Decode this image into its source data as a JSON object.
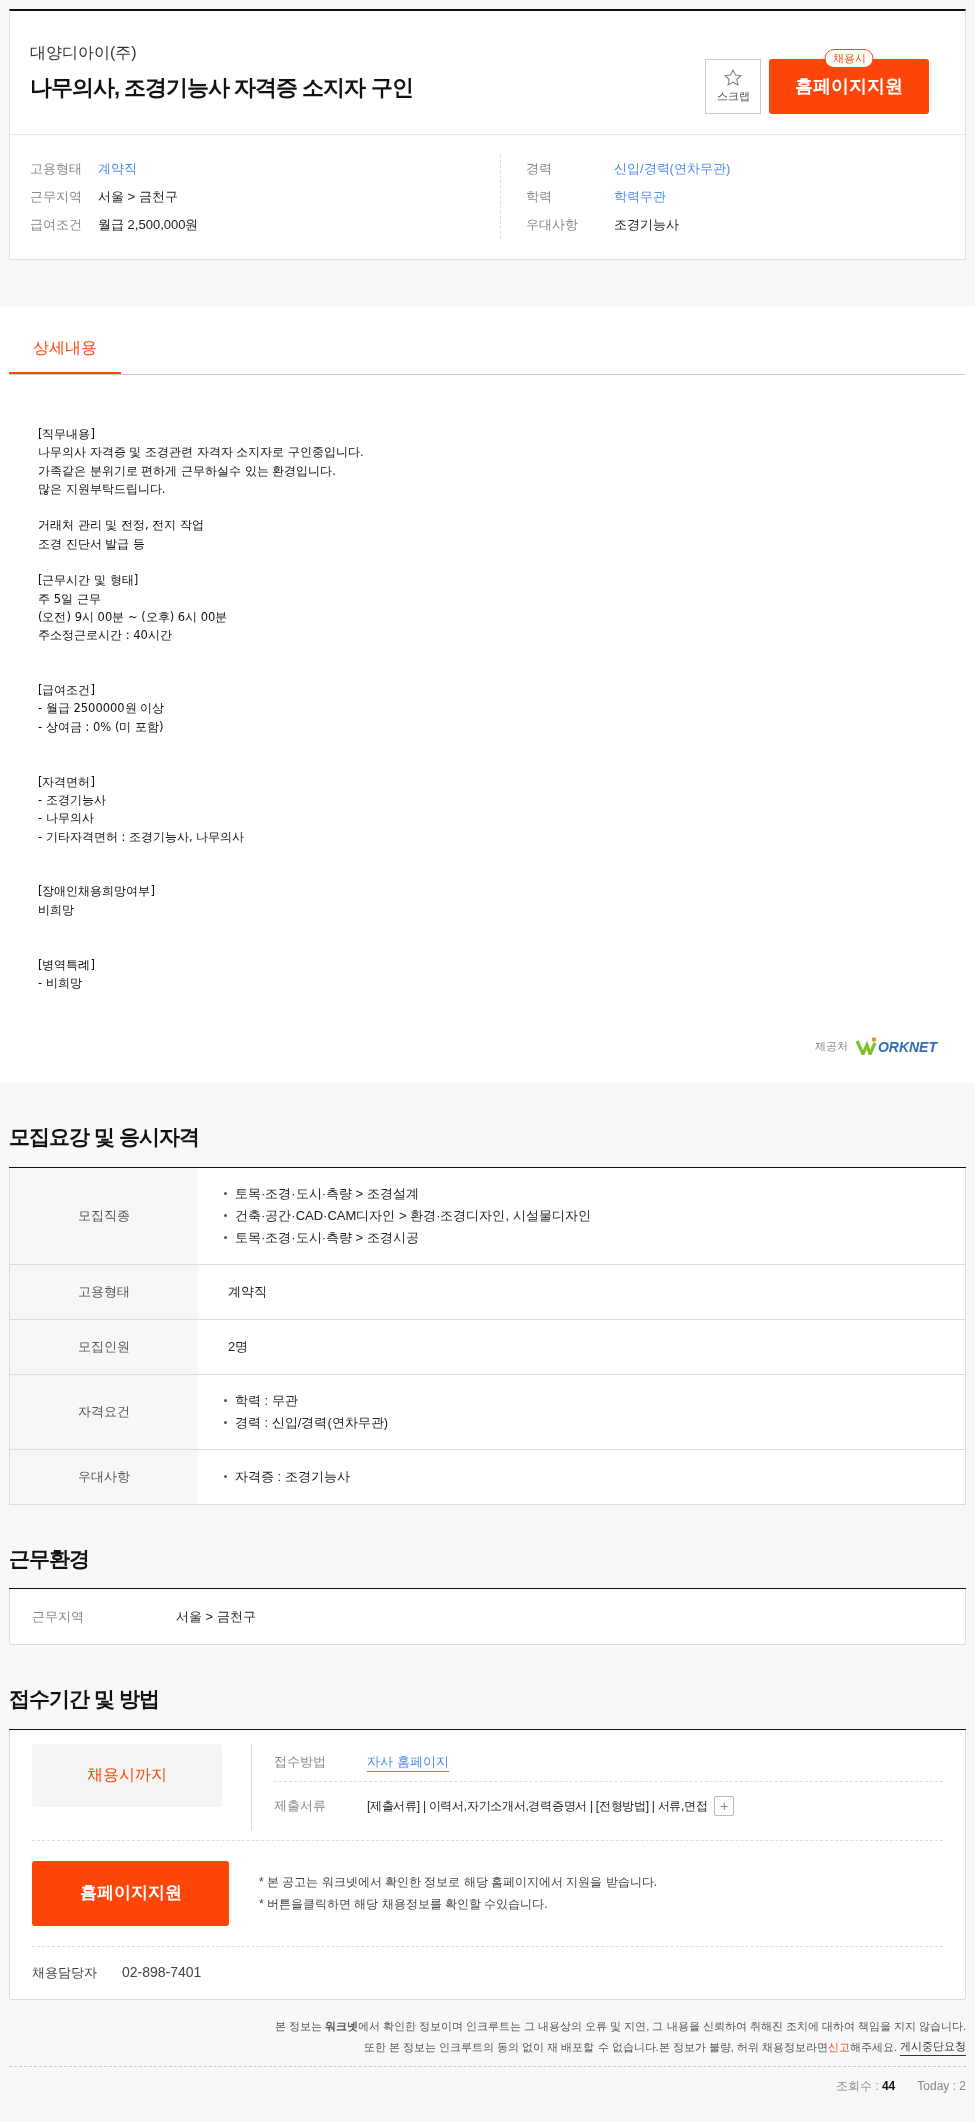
{
  "header": {
    "company": "대양디아이(주)",
    "title": "나무의사, 조경기능사 자격증 소지자 구인",
    "scrap_label": "스크랩",
    "apply_badge": "채용시",
    "apply_button": "홈페이지지원",
    "info_left": [
      {
        "label": "고용형태",
        "value": "계약직",
        "kind": "link"
      },
      {
        "label": "근무지역",
        "value": "서울 > 금천구",
        "kind": "plain"
      },
      {
        "label": "급여조건",
        "value": "월급 2,500,000원",
        "kind": "plain"
      }
    ],
    "info_right": [
      {
        "label": "경력",
        "value": "신입/경력(연차무관)",
        "kind": "link"
      },
      {
        "label": "학력",
        "value": "학력무관",
        "kind": "link"
      },
      {
        "label": "우대사항",
        "value": "조경기능사",
        "kind": "plain"
      }
    ]
  },
  "tabs": [
    {
      "label": "상세내용",
      "selected": true
    }
  ],
  "detail": {
    "body": "[직무내용]\n나무의사 자격증 및 조경관련 자격자 소지자로 구인중입니다.\n가족같은 분위기로 편하게 근무하실수 있는 환경입니다.\n많은 지원부탁드립니다.\n\n거래처 관리 및 전정, 전지 작업\n조경 진단서 발급 등\n\n[근무시간 및 형태]\n주 5일 근무\n(오전) 9시 00분 ~ (오후) 6시 00분\n주소정근로시간 : 40시간\n\n\n[급여조건]\n- 월급 2500000원 이상\n- 상여금 : 0% (미 포함)\n\n\n[자격면허]\n- 조경기능사\n- 나무의사\n- 기타자격면허 : 조경기능사, 나무의사\n\n\n[장애인채용희망여부]\n비희망\n\n\n[병역특례]\n- 비희망",
    "provider_label": "제공처",
    "provider_logo": "ORKNET"
  },
  "requirements": {
    "title": "모집요강 및 응시자격",
    "rows": [
      {
        "label": "모집직종",
        "items": [
          "토목·조경·도시·측량 > 조경설계",
          "건축·공간·CAD·CAM디자인 > 환경·조경디자인, 시설물디자인",
          "토목·조경·도시·측량 > 조경시공"
        ],
        "kind": "list"
      },
      {
        "label": "고용형태",
        "items": [
          "계약직"
        ],
        "kind": "plain"
      },
      {
        "label": "모집인원",
        "items": [
          "2명"
        ],
        "kind": "plain"
      },
      {
        "label": "자격요건",
        "items": [
          "학력 : 무관",
          "경력 : 신입/경력(연차무관)"
        ],
        "kind": "list"
      },
      {
        "label": "우대사항",
        "items": [
          "자격증 : 조경기능사"
        ],
        "kind": "list"
      }
    ]
  },
  "environment": {
    "title": "근무환경",
    "label": "근무지역",
    "value": "서울 > 금천구"
  },
  "application": {
    "title": "접수기간 및 방법",
    "period": "채용시까지",
    "method_label": "접수방법",
    "method_value": "자사 홈페이지",
    "docs_label": "제출서류",
    "docs_value": "[제출서류] | 이력서,자기소개서,경력증명서 | [전형방법] | 서류,면접",
    "more_button": "+",
    "apply_button": "홈페이지지원",
    "notes": [
      "* 본 공고는 워크넷에서 확인한 정보로 해당 홈페이지에서 지원을 받습니다.",
      "* 버튼을클릭하면 해당 채용정보를 확인할 수있습니다."
    ],
    "contact_label": "채용담당자",
    "contact_value": "02-898-7401"
  },
  "footer": {
    "disclaimer_1": "본 정보는 **워크넷**에서 확인한 정보이며 인크루트는 그 내용상의 오류 및 지연, 그 내용을 신뢰하여 취해진 조치에 대하여 책임을 지지 않습니다.",
    "disclaimer_2_before": "또한 본 정보는 인크루트의 동의 없이 재 배포할 수 없습니다.본 정보가 불량, 허위 채용정보라면",
    "report_link": "신고",
    "disclaimer_2_after": "해주세요.",
    "stop_link": "게시중단요청",
    "views_label": "조회수 :",
    "views_value": "44",
    "today": "Today : 2"
  }
}
